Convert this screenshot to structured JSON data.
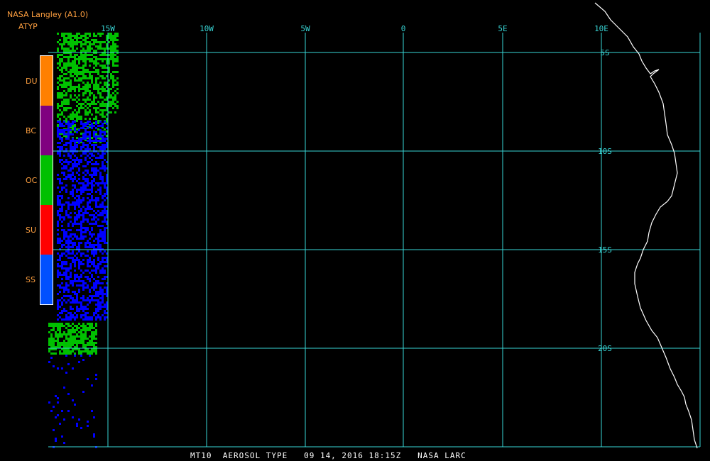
{
  "header": {
    "title": "NASA Langley (A1.0)",
    "subtitle": "ATYP"
  },
  "legend": {
    "items": [
      {
        "code": "DU",
        "color": "#ff8000"
      },
      {
        "code": "BC",
        "color": "#800080"
      },
      {
        "code": "OC",
        "color": "#00c000"
      },
      {
        "code": "SU",
        "color": "#ff0000"
      },
      {
        "code": "SS",
        "color": "#0050ff"
      }
    ]
  },
  "map": {
    "longitude_labels": [
      "15W",
      "10W",
      "5W",
      "0",
      "5E",
      "10E"
    ],
    "latitude_labels": [
      "5S",
      "10S",
      "15S",
      "20S"
    ],
    "grid_color": "#38d6d6",
    "coastline_color": "#ffffff",
    "aerosol_colors": {
      "ss": "#0000ff",
      "oc": "#00c000"
    }
  },
  "footer": {
    "text": "MT10  AEROSOL TYPE   09 14, 2016 18:15Z   NASA LARC"
  }
}
